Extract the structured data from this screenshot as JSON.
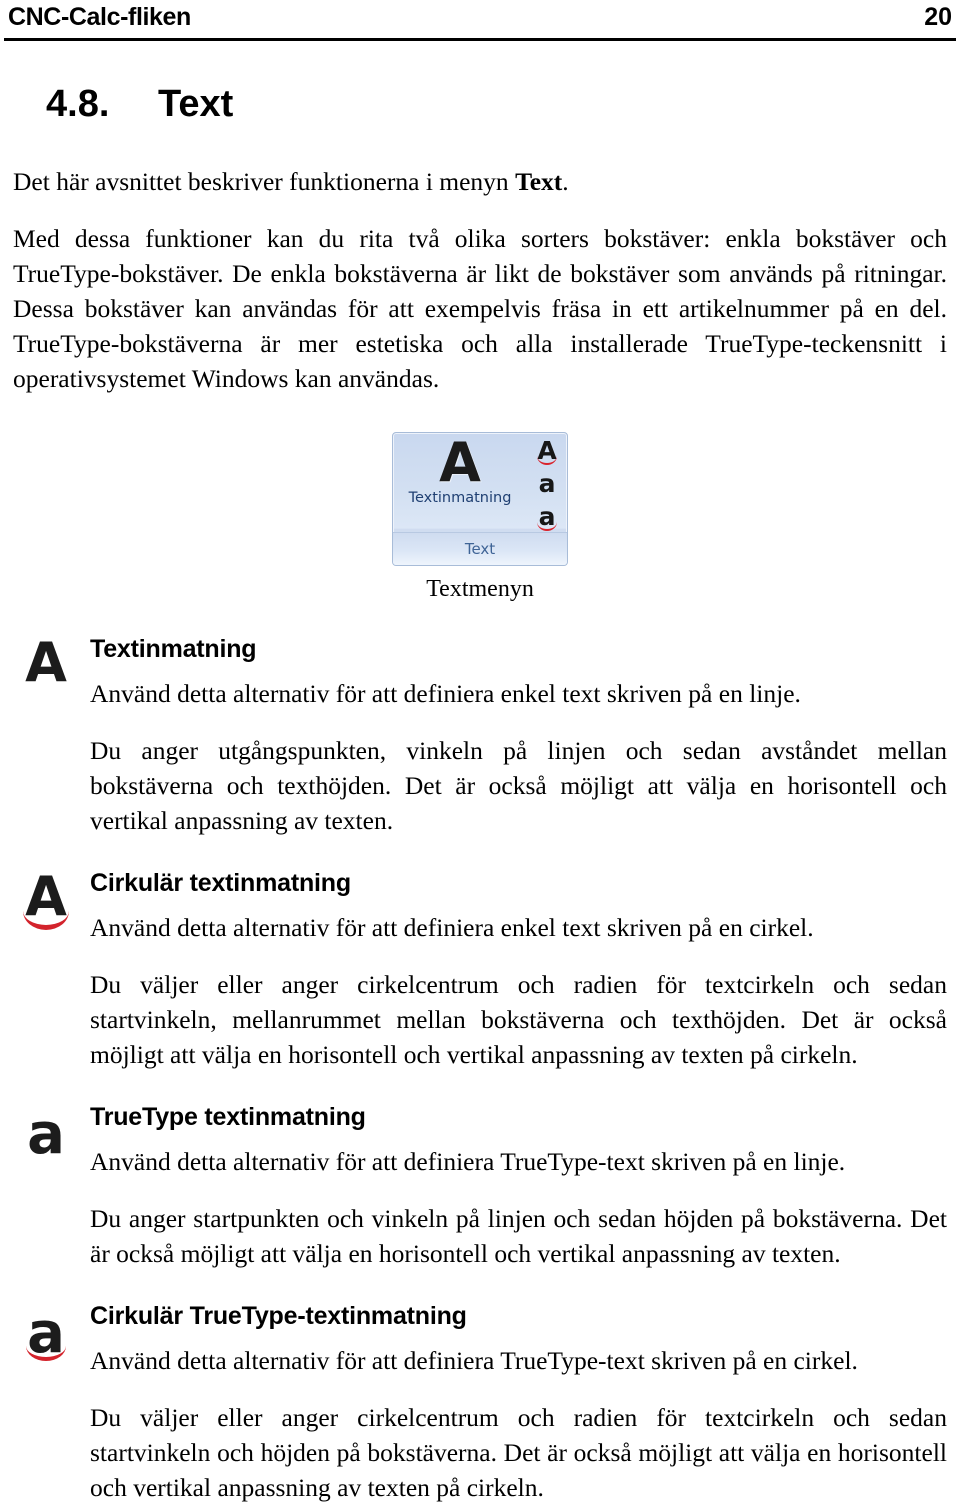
{
  "header": {
    "title": "CNC-Calc-fliken",
    "page_number": "20"
  },
  "section": {
    "number": "4.8.",
    "title": "Text",
    "heading_full": "4.8.  Text"
  },
  "intro": {
    "p1_before": "Det här avsnittet beskriver funktionerna i menyn ",
    "p1_bold": "Text",
    "p1_after": ".",
    "p2": "Med dessa funktioner kan du rita två olika sorters bokstäver: enkla bokstäver och TrueType-bokstäver. De enkla bokstäverna är likt de bokstäver som används på ritningar. Dessa bokstäver kan användas för att exempelvis fräsa in ett artikelnummer på en del. TrueType-bokstäverna är mer estetiska och alla installerade TrueType-teckensnitt i operativsystemet Windows kan användas."
  },
  "figure": {
    "caption": "Textmenyn",
    "panel": {
      "button_label": "Textinmatning",
      "button_glyph": "A",
      "group_label": "Text",
      "small_buttons": [
        {
          "glyph": "A",
          "arc": true
        },
        {
          "glyph": "a",
          "arc": false
        },
        {
          "glyph": "a",
          "arc": true
        }
      ],
      "colors": {
        "panel_bg_top": "#c9d8ef",
        "panel_bg_bottom": "#e3edf9",
        "panel_border": "#a8bcd8",
        "label_color": "#1f3f72",
        "group_label_color": "#3f6496",
        "arc_color": "#d3232c"
      }
    }
  },
  "options": [
    {
      "icon": {
        "glyph": "A",
        "arc": false,
        "name": "text-icon"
      },
      "heading": "Textinmatning",
      "paragraphs": [
        "Använd detta alternativ för att definiera enkel text skriven på en linje.",
        "Du anger utgångspunkten, vinkeln på linjen och sedan avståndet mellan bokstäverna och texthöjden. Det är också möjligt att välja en horisontell och vertikal anpassning av texten."
      ]
    },
    {
      "icon": {
        "glyph": "A",
        "arc": true,
        "name": "circular-text-icon"
      },
      "heading": "Cirkulär textinmatning",
      "paragraphs": [
        "Använd detta alternativ för att definiera enkel text skriven på en cirkel.",
        "Du väljer eller anger cirkelcentrum och radien för textcirkeln och sedan startvinkeln, mellanrummet mellan bokstäverna och texthöjden. Det är också möjligt att välja en horisontell och vertikal anpassning av texten på cirkeln."
      ]
    },
    {
      "icon": {
        "glyph": "a",
        "arc": false,
        "name": "truetype-text-icon"
      },
      "heading": "TrueType textinmatning",
      "paragraphs": [
        "Använd detta alternativ för att definiera TrueType-text skriven på en linje.",
        "Du anger startpunkten och vinkeln på linjen och sedan höjden på bokstäverna. Det är också möjligt att välja en horisontell och vertikal anpassning av texten."
      ]
    },
    {
      "icon": {
        "glyph": "a",
        "arc": true,
        "name": "circular-truetype-text-icon"
      },
      "heading": "Cirkulär TrueType-textinmatning",
      "paragraphs": [
        "Använd detta alternativ för att definiera TrueType-text skriven på en cirkel.",
        "Du väljer eller anger cirkelcentrum och radien för textcirkeln och sedan startvinkeln och höjden på bokstäverna. Det är också möjligt att välja en horisontell och vertikal anpassning av texten på cirkeln."
      ]
    }
  ]
}
